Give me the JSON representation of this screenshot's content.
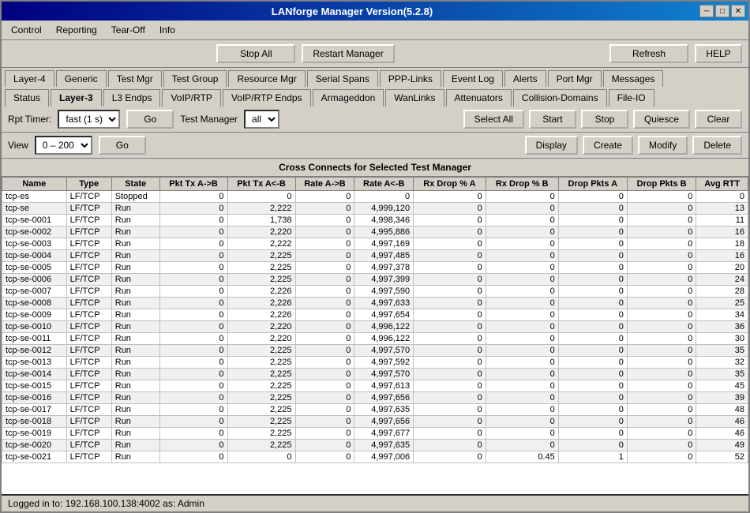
{
  "window": {
    "title": "LANforge Manager   Version(5.2.8)"
  },
  "title_buttons": {
    "minimize": "─",
    "maximize": "□",
    "close": "✕"
  },
  "menu": {
    "items": [
      "Control",
      "Reporting",
      "Tear-Off",
      "Info"
    ]
  },
  "toolbar": {
    "stop_all": "Stop All",
    "restart_manager": "Restart Manager",
    "refresh": "Refresh",
    "help": "HELP"
  },
  "tabs_row1": [
    {
      "label": "Layer-4",
      "active": false
    },
    {
      "label": "Generic",
      "active": false
    },
    {
      "label": "Test Mgr",
      "active": false
    },
    {
      "label": "Test Group",
      "active": false
    },
    {
      "label": "Resource Mgr",
      "active": false
    },
    {
      "label": "Serial Spans",
      "active": false
    },
    {
      "label": "PPP-Links",
      "active": false
    },
    {
      "label": "Event Log",
      "active": false
    },
    {
      "label": "Alerts",
      "active": false
    },
    {
      "label": "Port Mgr",
      "active": false
    },
    {
      "label": "Messages",
      "active": false
    }
  ],
  "tabs_row2": [
    {
      "label": "Status",
      "active": false
    },
    {
      "label": "Layer-3",
      "active": true
    },
    {
      "label": "L3 Endps",
      "active": false
    },
    {
      "label": "VoIP/RTP",
      "active": false
    },
    {
      "label": "VoIP/RTP Endps",
      "active": false
    },
    {
      "label": "Armageddon",
      "active": false
    },
    {
      "label": "WanLinks",
      "active": false
    },
    {
      "label": "Attenuators",
      "active": false
    },
    {
      "label": "Collision-Domains",
      "active": false
    },
    {
      "label": "File-IO",
      "active": false
    }
  ],
  "controls": {
    "rpt_timer_label": "Rpt Timer:",
    "rpt_timer_value": "fast",
    "rpt_timer_suffix": "(1 s)",
    "go_label": "Go",
    "test_manager_label": "Test Manager",
    "test_manager_value": "all",
    "select_all": "Select All",
    "start": "Start",
    "stop": "Stop",
    "quiesce": "Quiesce",
    "clear": "Clear"
  },
  "view": {
    "label": "View",
    "value": "0 – 200",
    "go_label": "Go",
    "display": "Display",
    "create": "Create",
    "modify": "Modify",
    "delete": "Delete"
  },
  "table": {
    "title": "Cross Connects for Selected Test Manager",
    "columns": [
      "Name",
      "Type",
      "State",
      "Pkt Tx A->B",
      "Pkt Tx A<-B",
      "Rate A->B",
      "Rate A<-B",
      "Rx Drop % A",
      "Rx Drop % B",
      "Drop Pkts A",
      "Drop Pkts B",
      "Avg RTT"
    ],
    "rows": [
      [
        "tcp-es",
        "LF/TCP",
        "Stopped",
        "0",
        "0",
        "0",
        "0",
        "0",
        "0",
        "0",
        "0",
        "0"
      ],
      [
        "tcp-se",
        "LF/TCP",
        "Run",
        "0",
        "2,222",
        "0",
        "4,999,120",
        "0",
        "0",
        "0",
        "0",
        "13"
      ],
      [
        "tcp-se-0001",
        "LF/TCP",
        "Run",
        "0",
        "1,738",
        "0",
        "4,998,346",
        "0",
        "0",
        "0",
        "0",
        "11"
      ],
      [
        "tcp-se-0002",
        "LF/TCP",
        "Run",
        "0",
        "2,220",
        "0",
        "4,995,886",
        "0",
        "0",
        "0",
        "0",
        "16"
      ],
      [
        "tcp-se-0003",
        "LF/TCP",
        "Run",
        "0",
        "2,222",
        "0",
        "4,997,169",
        "0",
        "0",
        "0",
        "0",
        "18"
      ],
      [
        "tcp-se-0004",
        "LF/TCP",
        "Run",
        "0",
        "2,225",
        "0",
        "4,997,485",
        "0",
        "0",
        "0",
        "0",
        "16"
      ],
      [
        "tcp-se-0005",
        "LF/TCP",
        "Run",
        "0",
        "2,225",
        "0",
        "4,997,378",
        "0",
        "0",
        "0",
        "0",
        "20"
      ],
      [
        "tcp-se-0006",
        "LF/TCP",
        "Run",
        "0",
        "2,225",
        "0",
        "4,997,399",
        "0",
        "0",
        "0",
        "0",
        "24"
      ],
      [
        "tcp-se-0007",
        "LF/TCP",
        "Run",
        "0",
        "2,226",
        "0",
        "4,997,590",
        "0",
        "0",
        "0",
        "0",
        "28"
      ],
      [
        "tcp-se-0008",
        "LF/TCP",
        "Run",
        "0",
        "2,226",
        "0",
        "4,997,633",
        "0",
        "0",
        "0",
        "0",
        "25"
      ],
      [
        "tcp-se-0009",
        "LF/TCP",
        "Run",
        "0",
        "2,226",
        "0",
        "4,997,654",
        "0",
        "0",
        "0",
        "0",
        "34"
      ],
      [
        "tcp-se-0010",
        "LF/TCP",
        "Run",
        "0",
        "2,220",
        "0",
        "4,996,122",
        "0",
        "0",
        "0",
        "0",
        "36"
      ],
      [
        "tcp-se-0011",
        "LF/TCP",
        "Run",
        "0",
        "2,220",
        "0",
        "4,996,122",
        "0",
        "0",
        "0",
        "0",
        "30"
      ],
      [
        "tcp-se-0012",
        "LF/TCP",
        "Run",
        "0",
        "2,225",
        "0",
        "4,997,570",
        "0",
        "0",
        "0",
        "0",
        "35"
      ],
      [
        "tcp-se-0013",
        "LF/TCP",
        "Run",
        "0",
        "2,225",
        "0",
        "4,997,592",
        "0",
        "0",
        "0",
        "0",
        "32"
      ],
      [
        "tcp-se-0014",
        "LF/TCP",
        "Run",
        "0",
        "2,225",
        "0",
        "4,997,570",
        "0",
        "0",
        "0",
        "0",
        "35"
      ],
      [
        "tcp-se-0015",
        "LF/TCP",
        "Run",
        "0",
        "2,225",
        "0",
        "4,997,613",
        "0",
        "0",
        "0",
        "0",
        "45"
      ],
      [
        "tcp-se-0016",
        "LF/TCP",
        "Run",
        "0",
        "2,225",
        "0",
        "4,997,656",
        "0",
        "0",
        "0",
        "0",
        "39"
      ],
      [
        "tcp-se-0017",
        "LF/TCP",
        "Run",
        "0",
        "2,225",
        "0",
        "4,997,635",
        "0",
        "0",
        "0",
        "0",
        "48"
      ],
      [
        "tcp-se-0018",
        "LF/TCP",
        "Run",
        "0",
        "2,225",
        "0",
        "4,997,656",
        "0",
        "0",
        "0",
        "0",
        "46"
      ],
      [
        "tcp-se-0019",
        "LF/TCP",
        "Run",
        "0",
        "2,225",
        "0",
        "4,997,677",
        "0",
        "0",
        "0",
        "0",
        "46"
      ],
      [
        "tcp-se-0020",
        "LF/TCP",
        "Run",
        "0",
        "2,225",
        "0",
        "4,997,635",
        "0",
        "0",
        "0",
        "0",
        "49"
      ],
      [
        "tcp-se-0021",
        "LF/TCP",
        "Run",
        "0",
        "0",
        "0",
        "4,997,006",
        "0",
        "0.45",
        "1",
        "0",
        "52"
      ]
    ]
  },
  "status_bar": {
    "text": "Logged in to:  192.168.100.138:4002  as:  Admin"
  }
}
